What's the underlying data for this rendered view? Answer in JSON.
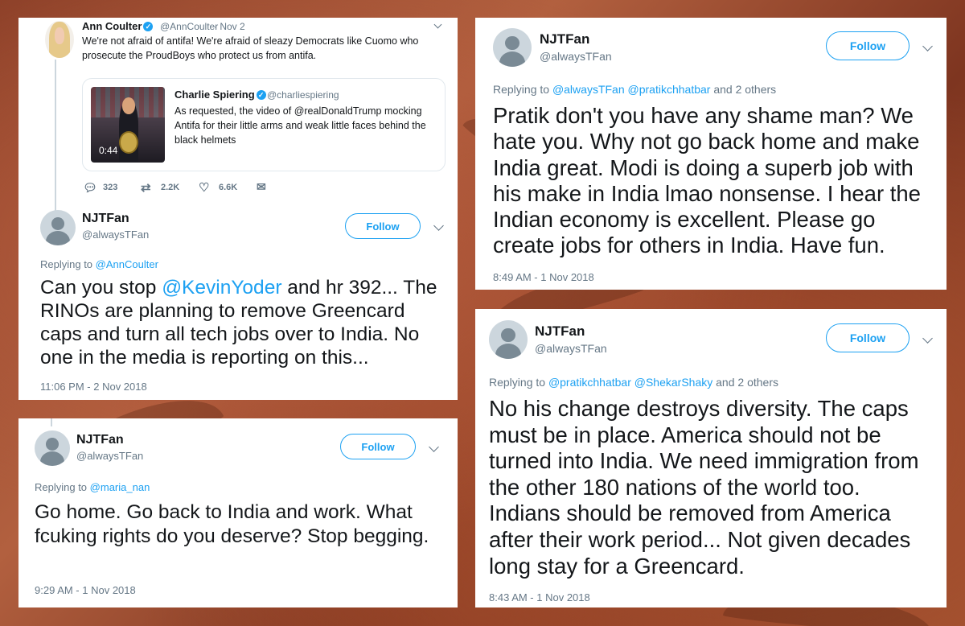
{
  "colors": {
    "accent": "#1da1f2",
    "muted_text": "#657786",
    "main_text": "#14171a",
    "background_tint": "#a4502f"
  },
  "tweet1": {
    "original": {
      "name": "Ann Coulter",
      "handle": "@AnnCoulter",
      "date": "· Nov 2",
      "text": "We're not afraid of antifa! We're afraid of sleazy Democrats like Cuomo who prosecute the ProudBoys who protect us from antifa.",
      "quote": {
        "name": "Charlie Spiering",
        "handle": "@charliespiering",
        "text": "As requested, the video of @realDonaldTrump mocking Antifa for their little arms and weak little faces behind the black helmets",
        "duration": "0:44"
      },
      "stats": {
        "replies": "323",
        "retweets": "2.2K",
        "likes": "6.6K"
      }
    },
    "reply": {
      "name": "NJTFan",
      "handle": "@alwaysTFan",
      "follow": "Follow",
      "replying_prefix": "Replying to",
      "replying_to": "@AnnCoulter",
      "text_before": "Can you stop ",
      "text_mention": "@KevinYoder",
      "text_after": " and hr 392... The RINOs are planning to remove Greencard caps and turn all tech jobs over to India. No one in the media is reporting on this...",
      "time": "11:06 PM - 2 Nov 2018"
    }
  },
  "tweet2": {
    "name": "NJTFan",
    "handle": "@alwaysTFan",
    "follow": "Follow",
    "replying_prefix": "Replying to",
    "replying_to": "@maria_nan",
    "text": "Go home. Go back to India and work. What fcuking rights do you deserve? Stop begging.",
    "time": "9:29 AM - 1 Nov 2018"
  },
  "tweet3": {
    "name": "NJTFan",
    "handle": "@alwaysTFan",
    "follow": "Follow",
    "replying_prefix": "Replying to",
    "replying_to": "@alwaysTFan @pratikchhatbar",
    "replying_suffix": "and 2 others",
    "text": "Pratik don't you have any shame man? We hate you. Why not go back home and make India great. Modi is doing a superb job with his make in India lmao nonsense. I hear the Indian economy is excellent. Please go create jobs for others in India. Have fun.",
    "time": "8:49 AM - 1 Nov 2018"
  },
  "tweet4": {
    "name": "NJTFan",
    "handle": "@alwaysTFan",
    "follow": "Follow",
    "replying_prefix": "Replying to",
    "replying_to": "@pratikchhatbar @ShekarShaky",
    "replying_suffix": "and 2 others",
    "text": "No his change destroys diversity. The caps must be in place. America should not be turned into India. We need immigration from the other 180 nations of the world too. Indians should be removed from America after their work period... Not given decades long stay for a Greencard.",
    "time": "8:43 AM - 1 Nov 2018"
  }
}
